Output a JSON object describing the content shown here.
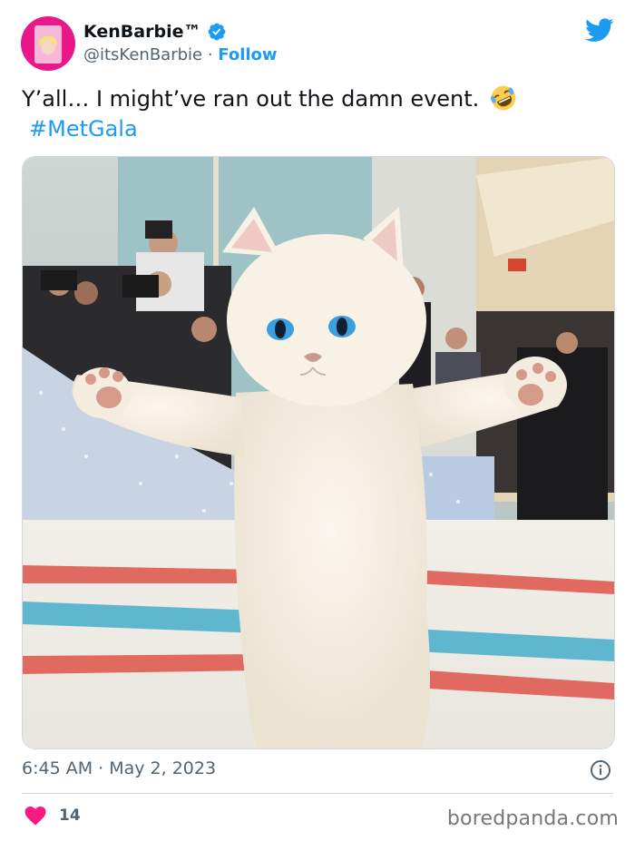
{
  "tweet": {
    "display_name": "KenBarbie™",
    "handle": "@itsKenBarbie",
    "separator": " · ",
    "follow_label": "Follow",
    "text": "Y’all… I might’ve ran out the damn event.",
    "emoji": "rolling-on-floor-laughing-emoji",
    "hashtag": "#MetGala",
    "timestamp": "6:45 AM · May 2, 2023",
    "like_count": "14"
  },
  "icons": {
    "verified": "verified-badge-icon",
    "twitter": "twitter-bird-icon",
    "info": "info-icon",
    "heart": "heart-icon"
  },
  "colors": {
    "link_blue": "#1d9bf0",
    "verified_blue": "#1d9bf0",
    "heart_pink": "#f91880",
    "secondary_text": "#536471",
    "border": "#cfd9de"
  },
  "watermark": "boredpanda.com"
}
